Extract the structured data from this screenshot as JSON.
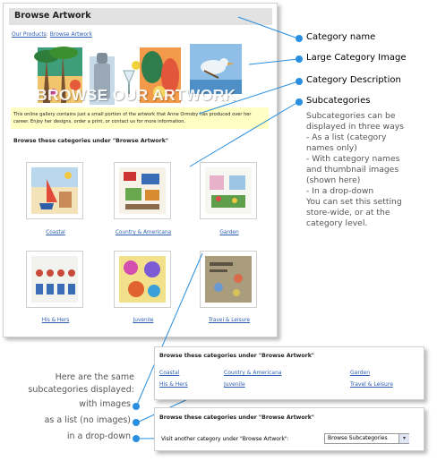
{
  "panel": {
    "title": "Browse Artwork",
    "breadcrumb": {
      "root": "Our Products",
      "separator": ": ",
      "current": "Browse Artwork"
    },
    "banner_text": "BROWSE OUR ARTWORK",
    "description": "This online gallery contains just a small portion of the artwork that Anne Ormsby has produced over her career. Enjoy her designs, order a print, or contact us for more information.",
    "browse_heading": "Browse these categories under \"Browse Artwork\"",
    "categories": [
      {
        "label": "Coastal",
        "icon": "coastal-thumbnail"
      },
      {
        "label": "Country & Americana",
        "icon": "country-thumbnail"
      },
      {
        "label": "Garden",
        "icon": "garden-thumbnail"
      },
      {
        "label": "His & Hers",
        "icon": "his-hers-thumbnail"
      },
      {
        "label": "Juvenile",
        "icon": "juvenile-thumbnail"
      },
      {
        "label": "Travel & Leisure",
        "icon": "travel-thumbnail"
      }
    ]
  },
  "callouts": {
    "category_name": "Category name",
    "large_image": "Large Category Image",
    "category_description": "Category Description",
    "subcategories": "Subcategories",
    "subcategories_desc": [
      "Subcategories can be",
      "displayed in three ways",
      "- As a list (category",
      "names only)",
      "- With category names",
      "and thumbnail images",
      "(shown here)",
      "- In a drop-down",
      "You can set this setting",
      "store-wide, or at the",
      "category level."
    ],
    "dot_color": "#2a8fe0"
  },
  "left_notes": {
    "line1": "Here are the same",
    "line2": "subcategories displayed:",
    "with_images": "with images",
    "as_list": "as a list (no images)",
    "dropdown": "in a drop-down"
  },
  "list_panel": {
    "heading": "Browse these categories under \"Browse Artwork\"",
    "items": [
      "Coastal",
      "Country & Americana",
      "Garden",
      "His & Hers",
      "Juvenile",
      "Travel & Leisure"
    ]
  },
  "drop_panel": {
    "heading": "Browse these categories under \"Browse Artwork\"",
    "prompt": "Visit another category under \"Browse Artwork\":",
    "select_value": "Browse Subcategories"
  }
}
